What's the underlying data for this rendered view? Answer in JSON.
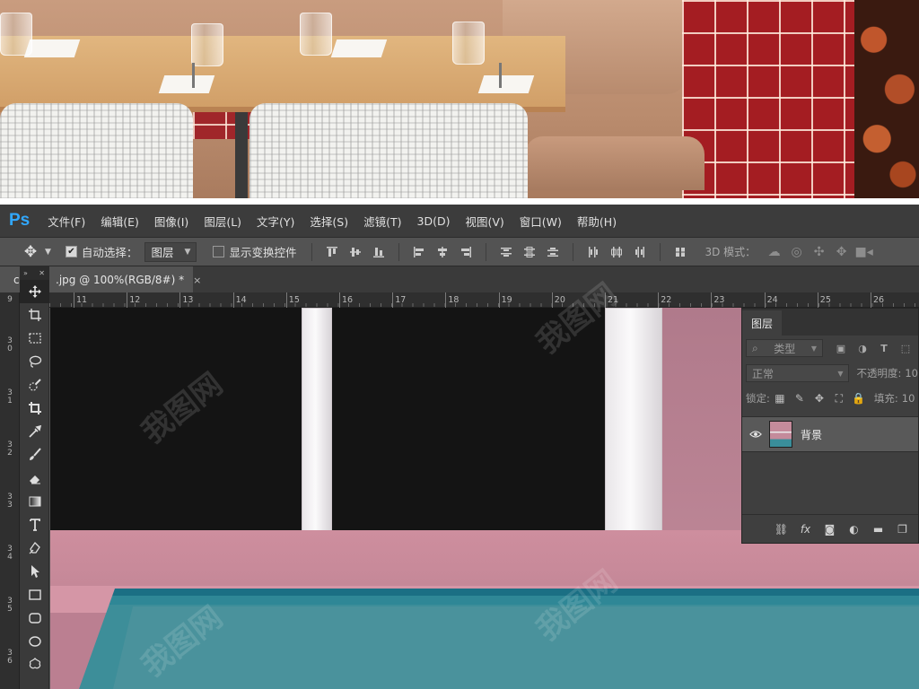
{
  "app": {
    "logo": "Ps"
  },
  "menu": [
    "文件(F)",
    "编辑(E)",
    "图像(I)",
    "图层(L)",
    "文字(Y)",
    "选择(S)",
    "滤镜(T)",
    "3D(D)",
    "视图(V)",
    "窗口(W)",
    "帮助(H)"
  ],
  "options": {
    "auto_select_label": "自动选择：",
    "auto_select_checked": true,
    "auto_select_target": "图层",
    "show_transform_label": "显示变换控件",
    "show_transform_checked": false,
    "mode_3d_label": "3D 模式："
  },
  "document": {
    "tab_prefix": "c",
    "tab_title": ".jpg @ 100%(RGB/8#) *",
    "close_symbol": "×"
  },
  "rulers": {
    "horizontal": [
      "11",
      "12",
      "13",
      "14",
      "15",
      "16",
      "17",
      "18",
      "19",
      "20",
      "21",
      "22",
      "23",
      "24",
      "25",
      "26"
    ],
    "vertical": [
      "9",
      "3 0",
      "3 1",
      "3 2",
      "3 3",
      "3 4",
      "3 5",
      "3 6"
    ]
  },
  "layers_panel": {
    "title": "图层",
    "filter_kind": "类型",
    "blend_mode": "正常",
    "opacity_label": "不透明度:",
    "opacity_value": "10",
    "lock_label": "锁定:",
    "fill_label": "填充:",
    "fill_value": "10",
    "layers": [
      {
        "name": "背景",
        "visible": true
      }
    ]
  },
  "watermark_text": "我图网"
}
